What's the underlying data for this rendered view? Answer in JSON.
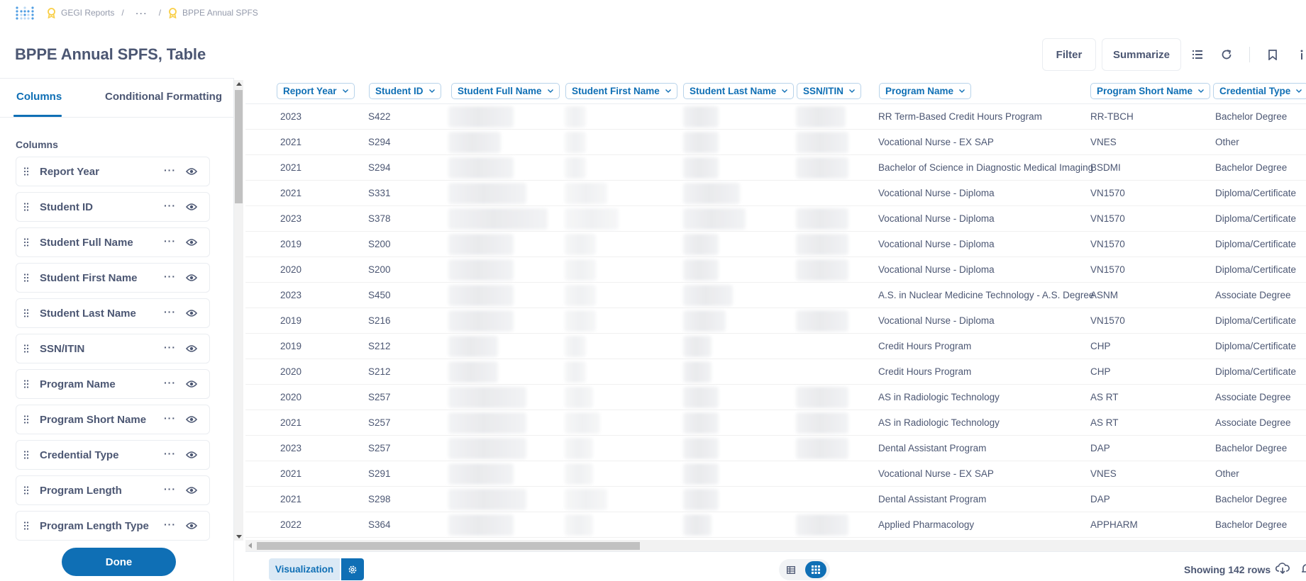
{
  "breadcrumb": {
    "items": [
      "GEGI Reports",
      "BPPE Annual SPFS"
    ],
    "ellipsis": "···",
    "separator": "/"
  },
  "page": {
    "title": "BPPE Annual SPFS, Table"
  },
  "toolbar": {
    "filter_label": "Filter",
    "summarize_label": "Summarize"
  },
  "left_panel": {
    "tabs": [
      "Columns",
      "Conditional Formatting"
    ],
    "active_tab": "Columns",
    "columns_heading": "Columns",
    "columns": [
      "Report Year",
      "Student ID",
      "Student Full Name",
      "Student First Name",
      "Student Last Name",
      "SSN/ITIN",
      "Program Name",
      "Program Short Name",
      "Credential Type",
      "Program Length",
      "Program Length Type"
    ],
    "more_glyph": "···",
    "done_label": "Done"
  },
  "table": {
    "headers": [
      "Report Year",
      "Student ID",
      "Student Full Name",
      "Student First Name",
      "Student Last Name",
      "SSN/ITIN",
      "Program Name",
      "Program Short Name",
      "Credential Type"
    ],
    "rows": [
      {
        "year": "2023",
        "id": "S422",
        "program": "RR Term-Based Credit Hours Program",
        "short": "RR-TBCH",
        "credential": "Bachelor Degree"
      },
      {
        "year": "2021",
        "id": "S294",
        "program": "Vocational Nurse - EX SAP",
        "short": "VNES",
        "credential": "Other"
      },
      {
        "year": "2021",
        "id": "S294",
        "program": "Bachelor of Science in Diagnostic Medical Imaging",
        "short": "BSDMI",
        "credential": "Bachelor Degree"
      },
      {
        "year": "2021",
        "id": "S331",
        "program": "Vocational Nurse - Diploma",
        "short": "VN1570",
        "credential": "Diploma/Certificate"
      },
      {
        "year": "2023",
        "id": "S378",
        "program": "Vocational Nurse - Diploma",
        "short": "VN1570",
        "credential": "Diploma/Certificate"
      },
      {
        "year": "2019",
        "id": "S200",
        "program": "Vocational Nurse - Diploma",
        "short": "VN1570",
        "credential": "Diploma/Certificate"
      },
      {
        "year": "2020",
        "id": "S200",
        "program": "Vocational Nurse - Diploma",
        "short": "VN1570",
        "credential": "Diploma/Certificate"
      },
      {
        "year": "2023",
        "id": "S450",
        "program": "A.S. in Nuclear Medicine Technology - A.S. Degree",
        "short": "ASNM",
        "credential": "Associate Degree"
      },
      {
        "year": "2019",
        "id": "S216",
        "program": "Vocational Nurse - Diploma",
        "short": "VN1570",
        "credential": "Diploma/Certificate"
      },
      {
        "year": "2019",
        "id": "S212",
        "program": "Credit Hours Program",
        "short": "CHP",
        "credential": "Diploma/Certificate"
      },
      {
        "year": "2020",
        "id": "S212",
        "program": "Credit Hours Program",
        "short": "CHP",
        "credential": "Diploma/Certificate"
      },
      {
        "year": "2020",
        "id": "S257",
        "program": "AS in Radiologic Technology",
        "short": "AS RT",
        "credential": "Associate Degree"
      },
      {
        "year": "2021",
        "id": "S257",
        "program": "AS in Radiologic Technology",
        "short": "AS RT",
        "credential": "Associate Degree"
      },
      {
        "year": "2023",
        "id": "S257",
        "program": "Dental Assistant Program",
        "short": "DAP",
        "credential": "Bachelor Degree"
      },
      {
        "year": "2021",
        "id": "S291",
        "program": "Vocational Nurse - EX SAP",
        "short": "VNES",
        "credential": "Other"
      },
      {
        "year": "2021",
        "id": "S298",
        "program": "Dental Assistant Program",
        "short": "DAP",
        "credential": "Bachelor Degree"
      },
      {
        "year": "2022",
        "id": "S364",
        "program": "Applied Pharmacology",
        "short": "APPHARM",
        "credential": "Bachelor Degree"
      }
    ]
  },
  "footer": {
    "visualization_label": "Visualization",
    "row_count": "Showing 142 rows"
  },
  "colors": {
    "accent": "#0f6fb5",
    "text": "#4c5773",
    "muted": "#949aab",
    "border": "#eaedf1",
    "badge": "#f9cf48"
  },
  "icons": [
    "metabase-logo-icon",
    "verified-badge-icon",
    "list-icon",
    "refresh-icon",
    "bookmark-icon",
    "info-icon",
    "grip-icon",
    "eye-icon",
    "chevron-down-icon",
    "gear-icon",
    "table-icon",
    "grid-icon",
    "download-icon",
    "bell-icon"
  ]
}
